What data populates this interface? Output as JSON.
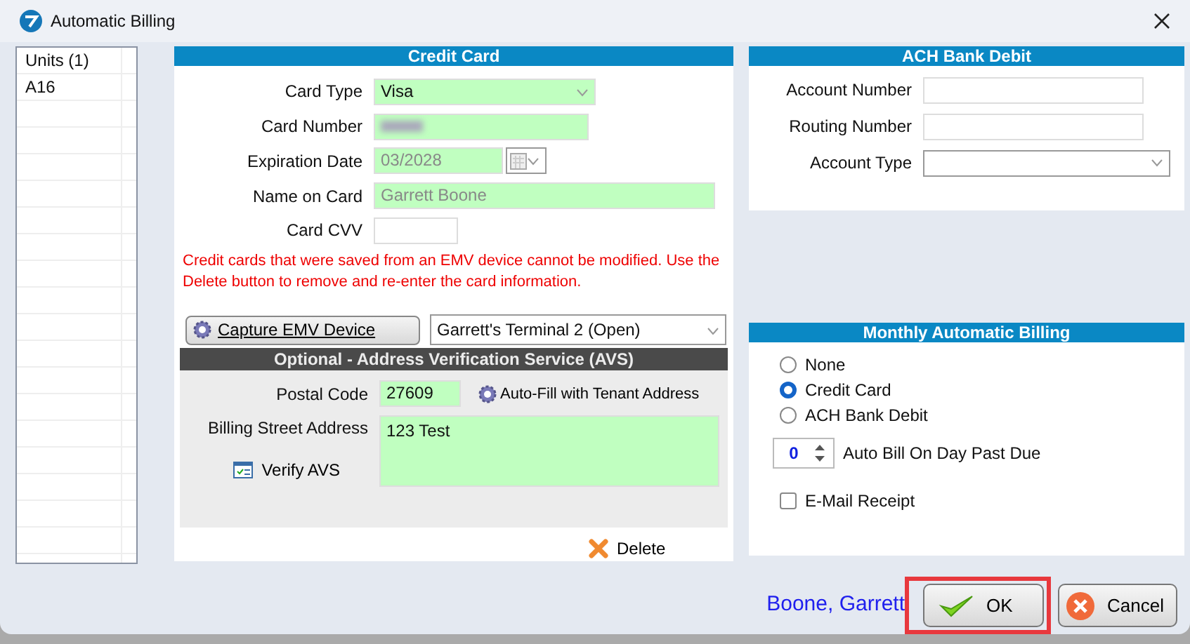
{
  "window": {
    "title": "Automatic Billing"
  },
  "units_list": {
    "header": "Units (1)",
    "rows": [
      "A16"
    ]
  },
  "credit_card": {
    "title": "Credit Card",
    "card_type": {
      "label": "Card Type",
      "value": "Visa",
      "disabled": false
    },
    "card_number": {
      "label": "Card Number"
    },
    "expiration_date": {
      "label": "Expiration Date",
      "value": "03/2028",
      "disabled": true
    },
    "name_on_card": {
      "label": "Name on Card",
      "value": "Garrett Boone",
      "disabled": true
    },
    "card_cvv": {
      "label": "Card CVV"
    },
    "warning": "Credit cards that were saved from an EMV device cannot be modified. Use the Delete button to remove and re-enter the card information.",
    "capture_button": "Capture EMV Device",
    "terminal": {
      "value": "Garrett's Terminal 2 (Open)"
    }
  },
  "avs": {
    "title": "Optional - Address Verification Service (AVS)",
    "postal_code": {
      "label": "Postal Code",
      "value": "27609"
    },
    "autofill_button": "Auto-Fill with Tenant Address",
    "street": {
      "label": "Billing Street Address",
      "value": "123 Test"
    },
    "verify_button": "Verify AVS"
  },
  "delete_button": "Delete",
  "ach": {
    "title": "ACH Bank Debit",
    "account_number": {
      "label": "Account Number"
    },
    "routing_number": {
      "label": "Routing Number"
    },
    "account_type": {
      "label": "Account Type"
    }
  },
  "monthly": {
    "title": "Monthly Automatic Billing",
    "options": [
      {
        "label": "None",
        "selected": false
      },
      {
        "label": "Credit Card",
        "selected": true
      },
      {
        "label": "ACH Bank Debit",
        "selected": false
      }
    ],
    "day_past_due": {
      "value": "0",
      "label": "Auto Bill On Day Past Due"
    },
    "email_receipt": {
      "label": "E-Mail Receipt",
      "checked": false
    }
  },
  "footer": {
    "tenant_name": "Boone, Garrett",
    "buttons": [
      {
        "label": "OK",
        "kind": "ok",
        "highlighted": true
      },
      {
        "label": "Cancel",
        "kind": "cancel",
        "highlighted": false
      }
    ]
  }
}
